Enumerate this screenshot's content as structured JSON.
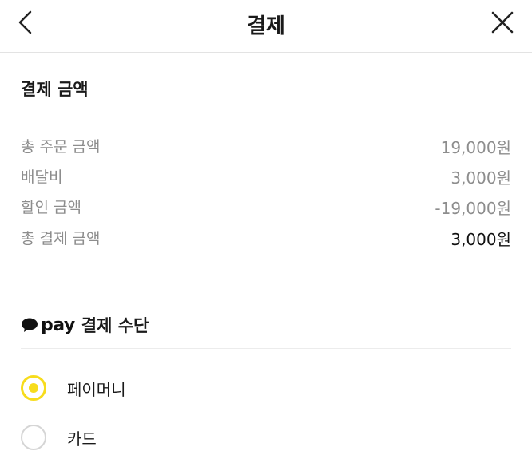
{
  "header": {
    "title": "결제",
    "back_icon": "chevron-left-icon",
    "close_icon": "close-icon"
  },
  "summary": {
    "title": "결제 금액",
    "rows": [
      {
        "label": "총 주문 금액",
        "value": "19,000원"
      },
      {
        "label": "배달비",
        "value": "3,000원"
      },
      {
        "label": "할인 금액",
        "value": "-19,000원"
      },
      {
        "label": "총 결제 금액",
        "value": "3,000원"
      }
    ]
  },
  "payment": {
    "brand_icon": "speech-bubble-icon",
    "brand": "pay",
    "title": "결제 수단",
    "accent_color": "#f7dc1c",
    "options": [
      {
        "label": "페이머니",
        "selected": true
      },
      {
        "label": "카드",
        "selected": false
      }
    ]
  }
}
